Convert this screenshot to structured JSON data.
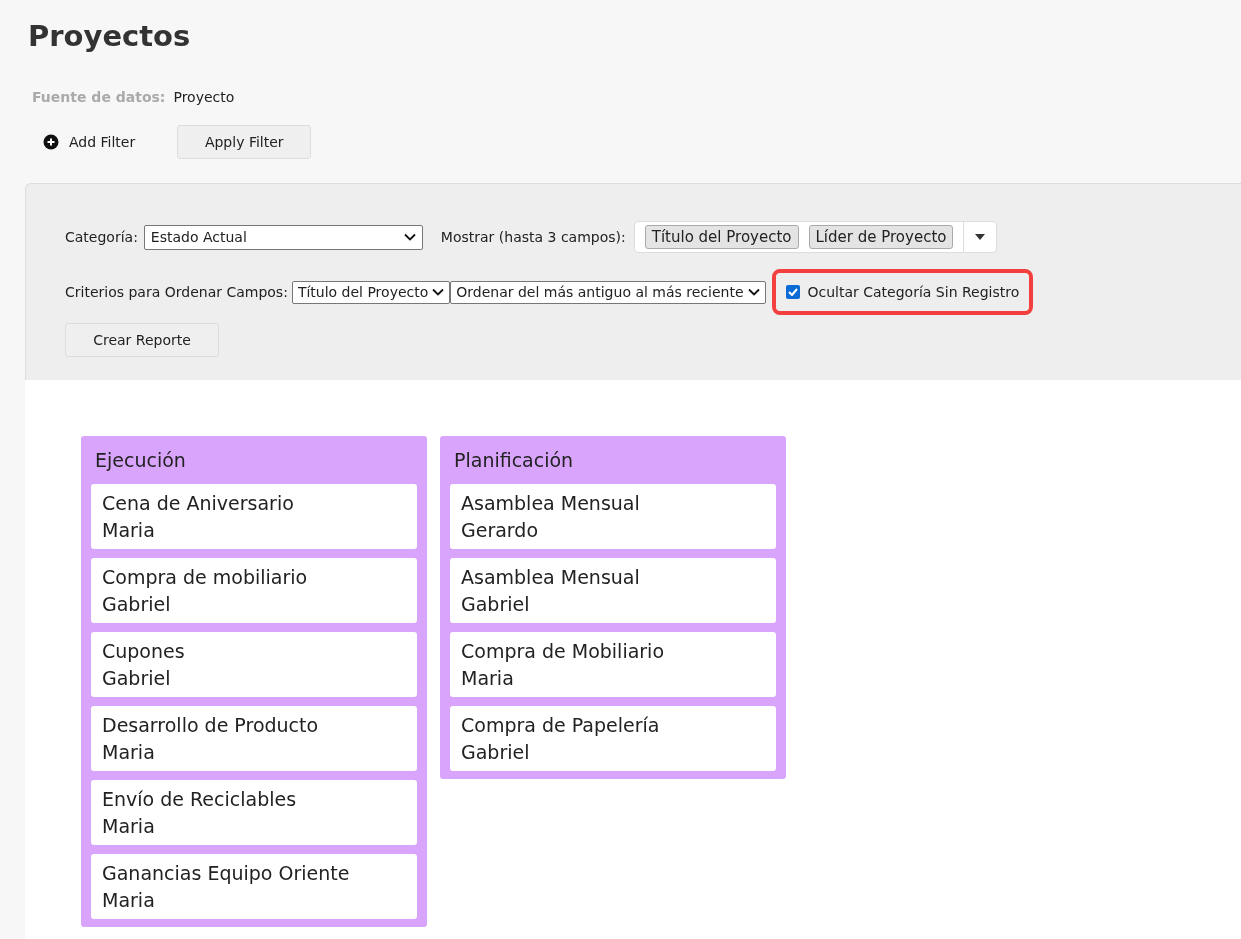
{
  "page": {
    "title": "Proyectos"
  },
  "data_source": {
    "label": "Fuente de datos:",
    "value": "Proyecto"
  },
  "filter_actions": {
    "add_filter": "Add Filter",
    "apply_filter": "Apply Filter"
  },
  "options": {
    "category": {
      "label": "Categoría:",
      "value": "Estado Actual"
    },
    "show": {
      "label": "Mostrar (hasta 3 campos):",
      "tags": [
        "Título del Proyecto",
        "Líder de Proyecto"
      ]
    },
    "sort": {
      "label": "Criterios para Ordenar Campos:",
      "field": "Título del Proyecto",
      "order": "Ordenar del más antiguo al más reciente"
    },
    "hide_empty": {
      "label": "Ocultar Categoría Sin Registro",
      "checked": true,
      "highlighted": true
    },
    "create_button": "Crear Reporte"
  },
  "board": [
    {
      "title": "Ejecución",
      "cards": [
        {
          "title": "Cena de Aniversario",
          "leader": "Maria"
        },
        {
          "title": "Compra de mobiliario",
          "leader": "Gabriel"
        },
        {
          "title": "Cupones",
          "leader": "Gabriel"
        },
        {
          "title": "Desarrollo de Producto",
          "leader": "Maria"
        },
        {
          "title": "Envío de Reciclables",
          "leader": "Maria"
        },
        {
          "title": "Ganancias Equipo Oriente",
          "leader": "Maria"
        }
      ]
    },
    {
      "title": "Planificación",
      "cards": [
        {
          "title": "Asamblea Mensual",
          "leader": "Gerardo"
        },
        {
          "title": "Asamblea Mensual",
          "leader": "Gabriel"
        },
        {
          "title": "Compra de Mobiliario",
          "leader": "Maria"
        },
        {
          "title": "Compra de Papelería",
          "leader": "Gabriel"
        }
      ]
    }
  ]
}
